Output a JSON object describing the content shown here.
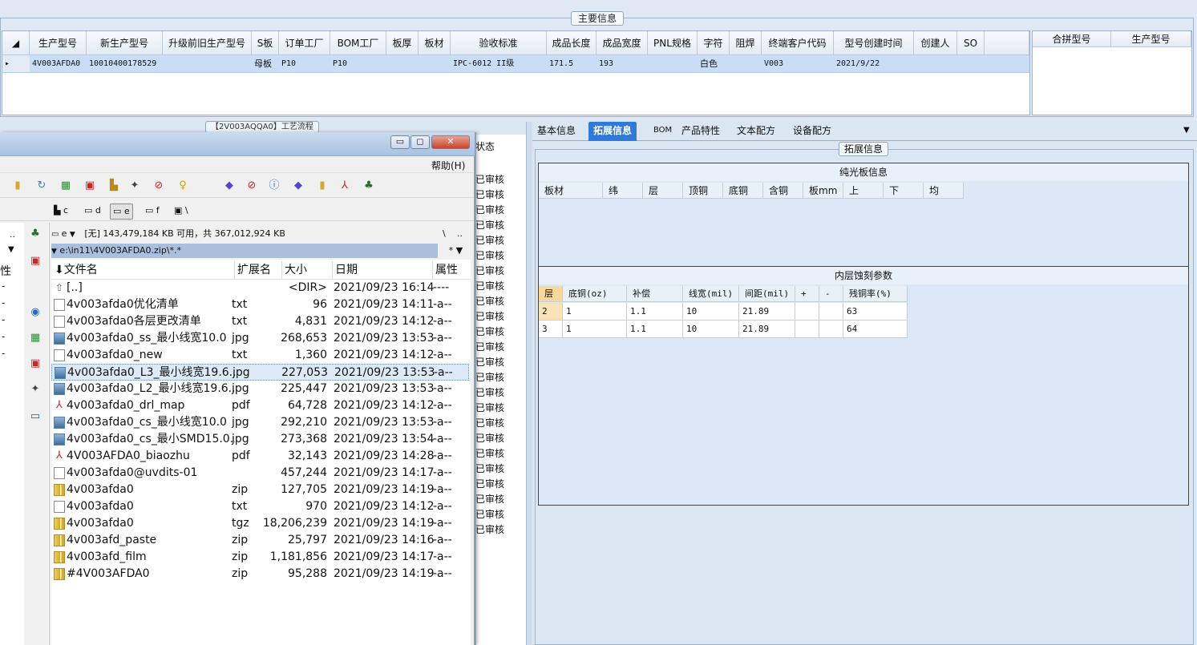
{
  "main_info": {
    "title": "主要信息",
    "columns": [
      "生产型号",
      "新生产型号",
      "升级前旧生产型号",
      "S板",
      "订单工厂",
      "BOM工厂",
      "板厚",
      "板材",
      "验收标准",
      "成品长度",
      "成品宽度",
      "PNL规格",
      "字符",
      "阻焊",
      "终端客户代码",
      "型号创建时间",
      "创建人",
      "SO"
    ],
    "row": {
      "prod_model": "4V003AFDA0",
      "new_prod_model": "10010400178529",
      "old_model": "",
      "s_board": "母板",
      "order_factory": "P10",
      "bom_factory": "P10",
      "thickness": "",
      "material": "",
      "standard": "IPC-6012 II级",
      "length": "171.5",
      "width": "193",
      "pnl": "",
      "char": "白色",
      "solder": "",
      "customer": "V003",
      "created": "2021/9/22",
      "creator": "",
      "so": ""
    },
    "side_columns": [
      "合拼型号",
      "生产型号"
    ]
  },
  "process_panel": {
    "title": "【2V003AQQA0】工艺流程",
    "status_header": "状态",
    "status_value": "已审核"
  },
  "right_panel": {
    "tabs": [
      "基本信息",
      "拓展信息",
      "BOM",
      "产品特性",
      "文本配方",
      "设备配方"
    ],
    "active_tab": "拓展信息",
    "ext_title": "拓展信息",
    "plain_section": {
      "title": "纯光板信息",
      "columns": [
        "板材",
        "纬",
        "层",
        "顶铜",
        "底铜",
        "含铜",
        "板mm",
        "上",
        "下",
        "均"
      ]
    },
    "etch_section": {
      "title": "内层蚀刻参数",
      "columns": [
        "层",
        "底铜(oz)",
        "补偿",
        "线宽(mil)",
        "间距(mil)",
        "+",
        "-",
        "残铜率(%)"
      ],
      "rows": [
        {
          "layer": "2",
          "base": "1",
          "comp": "1.1",
          "width": "10",
          "spacing": "21.89",
          "plus": "",
          "minus": "",
          "residual": "63"
        },
        {
          "layer": "3",
          "base": "1",
          "comp": "1.1",
          "width": "10",
          "spacing": "21.89",
          "plus": "",
          "minus": "",
          "residual": "64"
        }
      ]
    }
  },
  "file_manager": {
    "help_menu": "帮助(H)",
    "drives": [
      "c",
      "d",
      "e",
      "f",
      "\\"
    ],
    "current_drive": "e",
    "drive_info": "[无]  143,479,184 KB 可用，共 367,012,924 KB",
    "path": "e:\\in11\\4V003AFDA0.zip\\*.*",
    "path_suffix": "* ▼",
    "columns": {
      "name": "文件名",
      "ext": "扩展名",
      "size": "大小",
      "date": "日期",
      "attr": "属性"
    },
    "files": [
      {
        "icon": "up",
        "name": "[..]",
        "ext": "",
        "size": "<DIR>",
        "date": "2021/09/23 16:14",
        "attr": "----"
      },
      {
        "icon": "txt",
        "name": "4v003afda0优化清单",
        "ext": "txt",
        "size": "96",
        "date": "2021/09/23 14:11",
        "attr": "-a--"
      },
      {
        "icon": "txt",
        "name": "4v003afda0各层更改清单",
        "ext": "txt",
        "size": "4,831",
        "date": "2021/09/23 14:12",
        "attr": "-a--"
      },
      {
        "icon": "jpg",
        "name": "4v003afda0_ss_最小线宽10.0",
        "ext": "jpg",
        "size": "268,653",
        "date": "2021/09/23 13:53",
        "attr": "-a--"
      },
      {
        "icon": "txt",
        "name": "4v003afda0_new",
        "ext": "txt",
        "size": "1,360",
        "date": "2021/09/23 14:12",
        "attr": "-a--"
      },
      {
        "icon": "jpg",
        "name": "4v003afda0_L3_最小线宽19.6..",
        "ext": "jpg",
        "size": "227,053",
        "date": "2021/09/23 13:53",
        "attr": "-a--",
        "selected": true
      },
      {
        "icon": "jpg",
        "name": "4v003afda0_L2_最小线宽19.6..",
        "ext": "jpg",
        "size": "225,447",
        "date": "2021/09/23 13:53",
        "attr": "-a--"
      },
      {
        "icon": "pdf",
        "name": "4v003afda0_drl_map",
        "ext": "pdf",
        "size": "64,728",
        "date": "2021/09/23 14:12",
        "attr": "-a--"
      },
      {
        "icon": "jpg",
        "name": "4v003afda0_cs_最小线宽10.0",
        "ext": "jpg",
        "size": "292,210",
        "date": "2021/09/23 13:53",
        "attr": "-a--"
      },
      {
        "icon": "jpg",
        "name": "4v003afda0_cs_最小SMD15.0..",
        "ext": "jpg",
        "size": "273,368",
        "date": "2021/09/23 13:54",
        "attr": "-a--"
      },
      {
        "icon": "pdf",
        "name": "4V003AFDA0_biaozhu",
        "ext": "pdf",
        "size": "32,143",
        "date": "2021/09/23 14:28",
        "attr": "-a--"
      },
      {
        "icon": "txt",
        "name": "4v003afda0@uvdits-01",
        "ext": "",
        "size": "457,244",
        "date": "2021/09/23 14:17",
        "attr": "-a--"
      },
      {
        "icon": "zip",
        "name": "4v003afda0",
        "ext": "zip",
        "size": "127,705",
        "date": "2021/09/23 14:19",
        "attr": "-a--"
      },
      {
        "icon": "txt",
        "name": "4v003afda0",
        "ext": "txt",
        "size": "970",
        "date": "2021/09/23 14:12",
        "attr": "-a--"
      },
      {
        "icon": "zip",
        "name": "4v003afda0",
        "ext": "tgz",
        "size": "18,206,239",
        "date": "2021/09/23 14:19",
        "attr": "-a--"
      },
      {
        "icon": "zip",
        "name": "4v003afd_paste",
        "ext": "zip",
        "size": "25,797",
        "date": "2021/09/23 14:16",
        "attr": "-a--"
      },
      {
        "icon": "zip",
        "name": "4v003afd_film",
        "ext": "zip",
        "size": "1,181,856",
        "date": "2021/09/23 14:17",
        "attr": "-a--"
      },
      {
        "icon": "zip",
        "name": "#4V003AFDA0",
        "ext": "zip",
        "size": "95,288",
        "date": "2021/09/23 14:19",
        "attr": "-a--"
      }
    ],
    "left_strip": {
      "header_dots": "..",
      "header_attr": "性",
      "dashes": [
        "-",
        "-",
        "-",
        "-",
        "-"
      ]
    }
  }
}
